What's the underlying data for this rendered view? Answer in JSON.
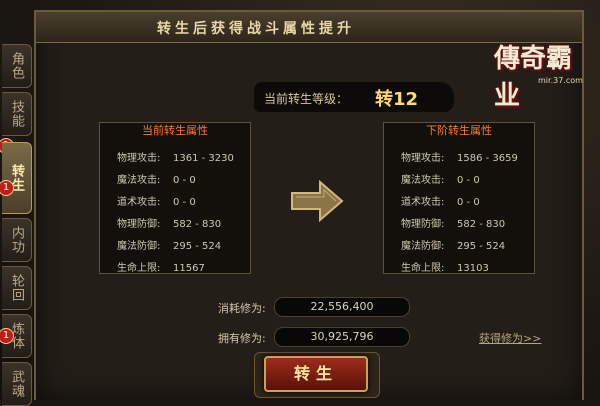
{
  "header": {
    "title": "转生后获得战斗属性提升"
  },
  "logo": {
    "text": "傳奇霸业",
    "url": "mir.37.com"
  },
  "tabs": [
    {
      "label": "角色",
      "badge": ""
    },
    {
      "label": "技能",
      "badge": "1"
    },
    {
      "label": "转生",
      "badge": "1",
      "active": true
    },
    {
      "label": "内功",
      "badge": ""
    },
    {
      "label": "轮回",
      "badge": ""
    },
    {
      "label": "炼体",
      "badge": "1"
    },
    {
      "label": "武魂",
      "badge": ""
    }
  ],
  "level": {
    "label": "当前转生等级：",
    "value": "转12"
  },
  "current": {
    "title": "当前转生属性",
    "rows": [
      {
        "k": "物理攻击:",
        "v": "1361 - 3230"
      },
      {
        "k": "魔法攻击:",
        "v": "0 - 0"
      },
      {
        "k": "道术攻击:",
        "v": "0 - 0"
      },
      {
        "k": "物理防御:",
        "v": "582 - 830"
      },
      {
        "k": "魔法防御:",
        "v": "295 - 524"
      },
      {
        "k": "生命上限:",
        "v": "11567"
      }
    ]
  },
  "next": {
    "title": "下阶转生属性",
    "rows": [
      {
        "k": "物理攻击:",
        "v": "1586 - 3659"
      },
      {
        "k": "魔法攻击:",
        "v": "0 - 0"
      },
      {
        "k": "道术攻击:",
        "v": "0 - 0"
      },
      {
        "k": "物理防御:",
        "v": "582 - 830"
      },
      {
        "k": "魔法防御:",
        "v": "295 - 524"
      },
      {
        "k": "生命上限:",
        "v": "13103"
      }
    ]
  },
  "cost": {
    "label": "消耗修为:",
    "value": "22,556,400"
  },
  "owned": {
    "label": "拥有修为:",
    "value": "30,925,796"
  },
  "get_link": "获得修为>>",
  "button": "转生",
  "colors": {
    "accent": "#ffd96b",
    "title_orange": "#ff7a2a",
    "button": "#9c2c1c"
  }
}
